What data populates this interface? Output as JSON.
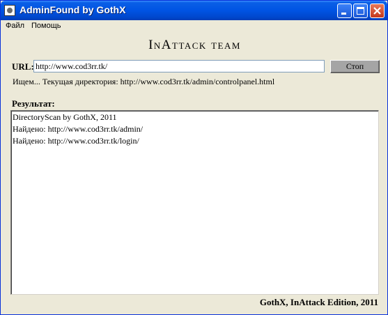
{
  "window": {
    "title": "AdminFound by GothX"
  },
  "menu": {
    "file": "Файл",
    "help": "Помощь"
  },
  "heading": "InAttack team",
  "url": {
    "label": "URL:",
    "value": "http://www.cod3rr.tk/"
  },
  "stop_button": "Стоп",
  "status": "Ищем... Текущая директория:  http://www.cod3rr.tk/admin/controlpanel.html",
  "result": {
    "label": "Результат:",
    "lines": [
      "DirectoryScan by GothX, 2011",
      "Найдено:   http://www.cod3rr.tk/admin/",
      "Найдено:   http://www.cod3rr.tk/login/"
    ]
  },
  "footer": "GothX, InAttack Edition, 2011",
  "icons": {
    "app": "app-icon",
    "minimize": "minimize-icon",
    "maximize": "maximize-icon",
    "close": "close-icon"
  },
  "colors": {
    "titlebar": "#0054E3",
    "window_bg": "#ECE9D8",
    "stop_button": "#A5A5A5"
  }
}
